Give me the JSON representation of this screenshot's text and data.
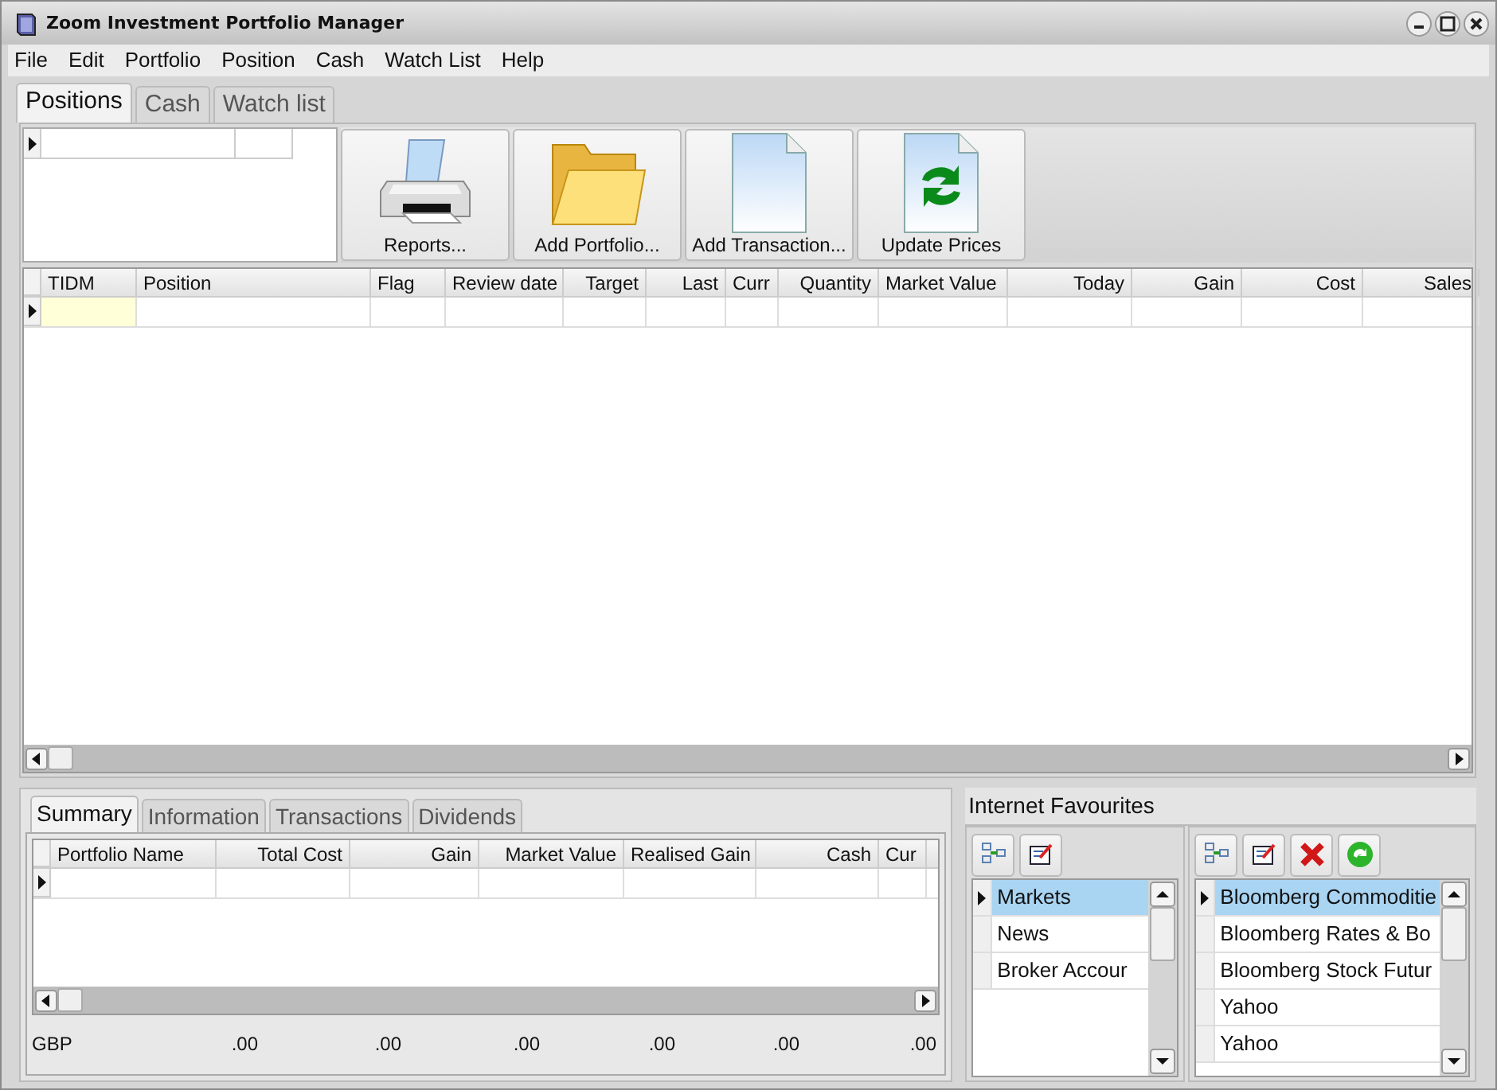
{
  "window": {
    "title": "Zoom Investment Portfolio Manager"
  },
  "menu": [
    "File",
    "Edit",
    "Portfolio",
    "Position",
    "Cash",
    "Watch List",
    "Help"
  ],
  "tabs": [
    {
      "label": "Positions",
      "selected": true
    },
    {
      "label": "Cash",
      "selected": false
    },
    {
      "label": "Watch list",
      "selected": false
    }
  ],
  "toolbar": [
    {
      "label": "Reports...",
      "kind": "printer"
    },
    {
      "label": "Add Portfolio...",
      "kind": "folder"
    },
    {
      "label": "Add Transaction...",
      "kind": "document"
    },
    {
      "label": "Update Prices",
      "kind": "refresh"
    }
  ],
  "positions_table": {
    "columns": [
      "TIDM",
      "Position",
      "Flag",
      "Review date",
      "Target",
      "Last",
      "Curr",
      "Quantity",
      "Market Value",
      "Today",
      "Gain",
      "Cost",
      "Sales"
    ]
  },
  "bottom_tabs": [
    {
      "label": "Summary",
      "selected": true
    },
    {
      "label": "Information",
      "selected": false
    },
    {
      "label": "Transactions",
      "selected": false
    },
    {
      "label": "Dividends",
      "selected": false
    }
  ],
  "summary_table": {
    "columns": [
      "Portfolio Name",
      "Total Cost",
      "Gain",
      "Market Value",
      "Realised Gain",
      "Cash",
      "Cur"
    ],
    "totals": [
      "GBP",
      ".00",
      ".00",
      ".00",
      ".00",
      ".00",
      ".00"
    ]
  },
  "favourites": {
    "title": "Internet Favourites",
    "category_tools": [
      {
        "kind": "add"
      },
      {
        "kind": "edit"
      }
    ],
    "link_tools": [
      {
        "kind": "add"
      },
      {
        "kind": "edit"
      },
      {
        "kind": "delete"
      },
      {
        "kind": "refresh"
      }
    ],
    "categories": [
      {
        "label": "Markets",
        "selected": true
      },
      {
        "label": "News",
        "selected": false
      },
      {
        "label": "Broker Accour",
        "selected": false
      }
    ],
    "links": [
      {
        "label": "Bloomberg Commoditie",
        "selected": true
      },
      {
        "label": "Bloomberg Rates & Bo",
        "selected": false
      },
      {
        "label": "Bloomberg Stock Futur",
        "selected": false
      },
      {
        "label": "Yahoo",
        "selected": false
      },
      {
        "label": "Yahoo",
        "selected": false
      }
    ]
  }
}
